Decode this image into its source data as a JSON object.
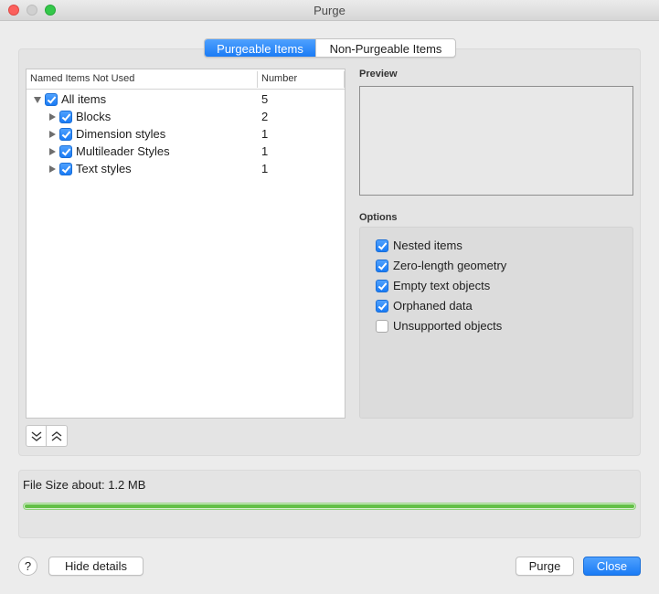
{
  "window": {
    "title": "Purge"
  },
  "tabs": [
    {
      "label": "Purgeable Items",
      "active": true
    },
    {
      "label": "Non-Purgeable Items",
      "active": false
    }
  ],
  "tree": {
    "columns": [
      "Named Items Not Used",
      "Number"
    ],
    "rows": [
      {
        "label": "All items",
        "count": "5",
        "checked": true,
        "expanded": true,
        "level": 0
      },
      {
        "label": "Blocks",
        "count": "2",
        "checked": true,
        "expanded": false,
        "level": 1
      },
      {
        "label": "Dimension styles",
        "count": "1",
        "checked": true,
        "expanded": false,
        "level": 1
      },
      {
        "label": "Multileader Styles",
        "count": "1",
        "checked": true,
        "expanded": false,
        "level": 1
      },
      {
        "label": "Text styles",
        "count": "1",
        "checked": true,
        "expanded": false,
        "level": 1
      }
    ]
  },
  "preview": {
    "label": "Preview"
  },
  "options": {
    "label": "Options",
    "items": [
      {
        "label": "Nested items",
        "checked": true
      },
      {
        "label": "Zero-length geometry",
        "checked": true
      },
      {
        "label": "Empty text objects",
        "checked": true
      },
      {
        "label": "Orphaned data",
        "checked": true
      },
      {
        "label": "Unsupported objects",
        "checked": false
      }
    ]
  },
  "filesize": {
    "label": "File Size about: 1.2 MB",
    "progress_fraction": 1.0
  },
  "footer": {
    "help_label": "?",
    "hide_details_label": "Hide details",
    "purge_label": "Purge",
    "close_label": "Close"
  },
  "colors": {
    "accent": "#1a7bf5",
    "progress": "#63c046"
  }
}
